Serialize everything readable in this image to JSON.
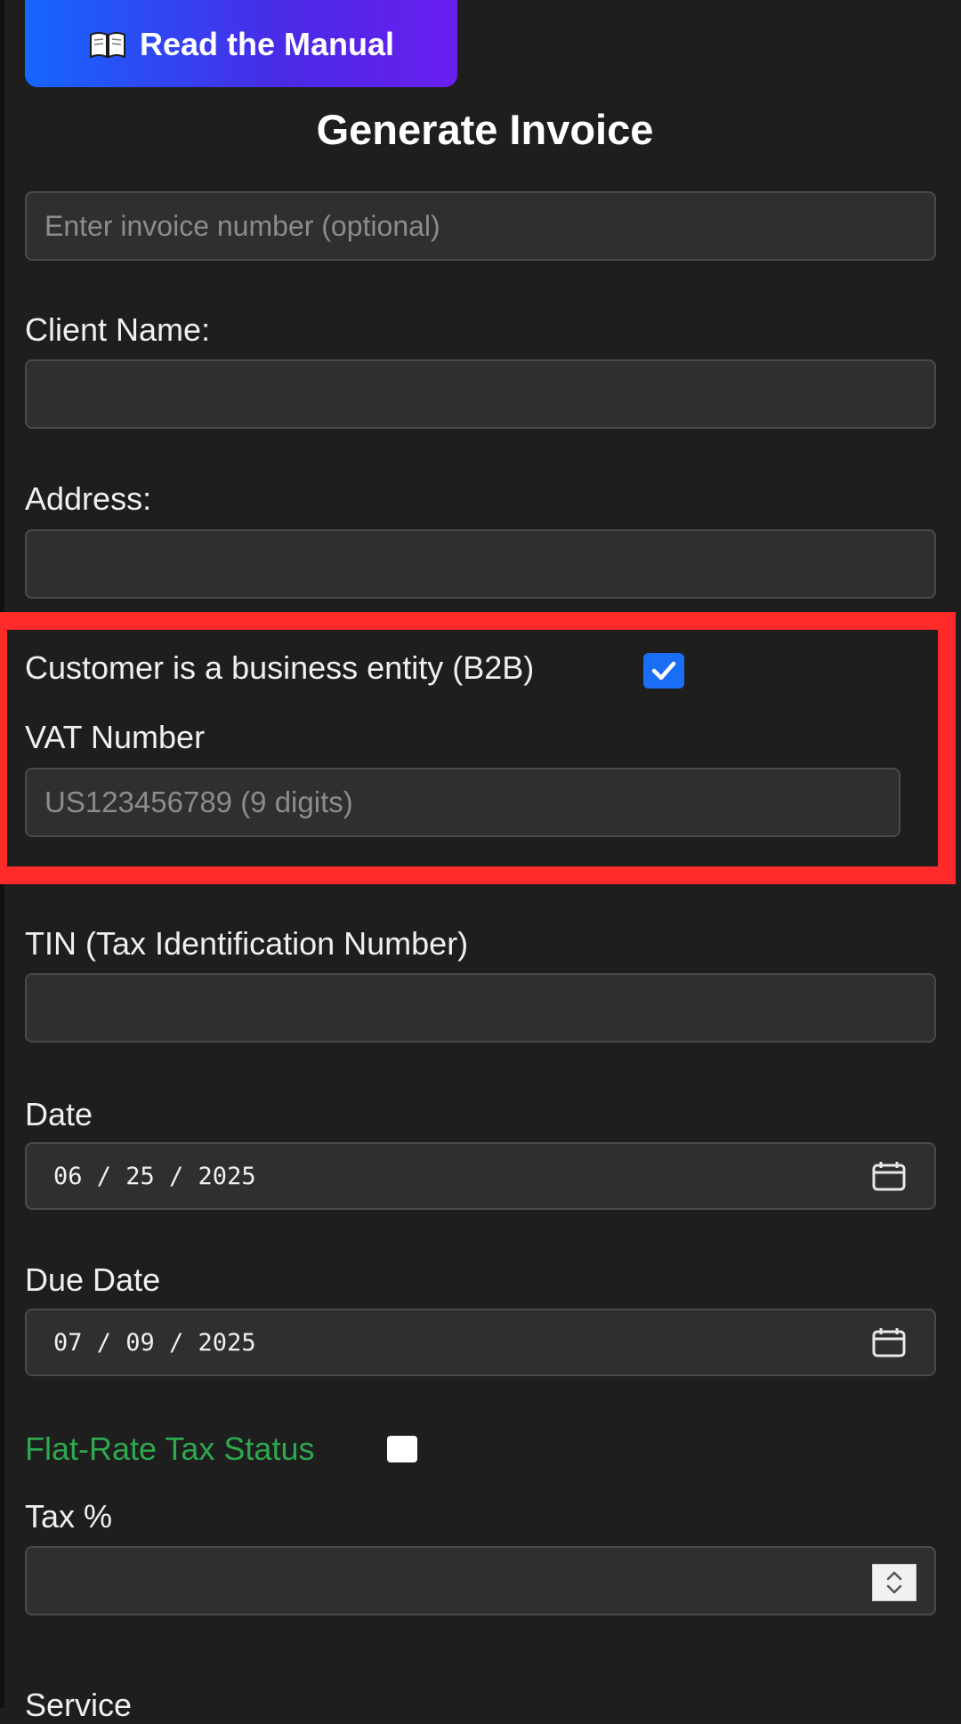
{
  "header": {
    "manual_button_label": "Read the Manual",
    "manual_icon": "open-book-icon",
    "title": "Generate Invoice"
  },
  "form": {
    "invoice_number": {
      "placeholder": "Enter invoice number (optional)",
      "value": ""
    },
    "client_name": {
      "label": "Client Name:",
      "value": ""
    },
    "address": {
      "label": "Address:",
      "value": ""
    },
    "b2b": {
      "label": "Customer is a business entity (B2B)",
      "checked": true
    },
    "vat_number": {
      "label": "VAT Number",
      "placeholder": "US123456789 (9 digits)",
      "value": ""
    },
    "tin": {
      "label": "TIN (Tax Identification Number)",
      "value": ""
    },
    "date": {
      "label": "Date",
      "value": "06 / 25 / 2025",
      "icon": "calendar-icon"
    },
    "due_date": {
      "label": "Due Date",
      "value": "07 / 09 / 2025",
      "icon": "calendar-icon"
    },
    "flat_rate": {
      "label": "Flat-Rate Tax Status",
      "checked": false
    },
    "tax_percent": {
      "label": "Tax %",
      "value": ""
    },
    "next_label_partial": "Service"
  },
  "colors": {
    "background": "#1e1e1e",
    "input_background": "#2f2f2f",
    "highlight_border": "#ff2b2b",
    "checkbox_blue": "#1a6ef5",
    "flat_rate_green": "#2ea84f",
    "button_gradient_start": "#1466ff",
    "button_gradient_end": "#6a1ef0"
  }
}
